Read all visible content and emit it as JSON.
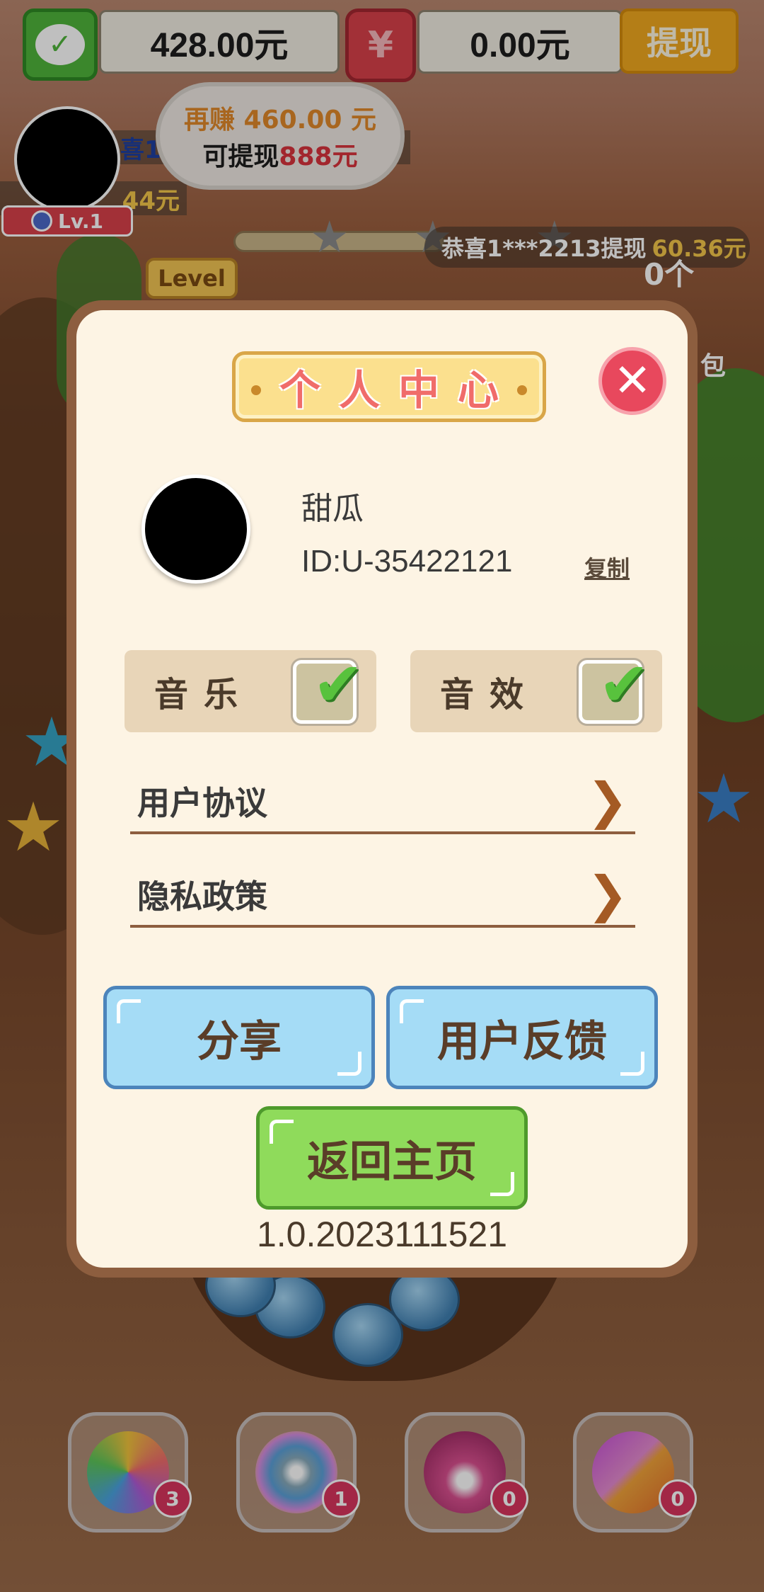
{
  "topbar": {
    "wechat_balance": "428.00元",
    "red_packet_balance": "0.00元",
    "withdraw_label": "提现",
    "yuan_glyph": "¥"
  },
  "player": {
    "level": "Lv.1",
    "obscured_fragment_1": "喜1",
    "obscured_fragment_2": "44元"
  },
  "cloud_tip": {
    "line1": "再赚 460.00 元",
    "line2_prefix": "可提现",
    "line2_amount": "888元"
  },
  "ticker": {
    "text": "恭喜1***2213提现",
    "amount": "60.36元"
  },
  "level_tab": "Level",
  "counter_label": "0个",
  "side_label": "包",
  "modal": {
    "title": "个人中心",
    "close_glyph": "✕",
    "nickname": "甜瓜",
    "user_id": "ID:U-35422121",
    "copy_label": "复制",
    "music_label": "音乐",
    "sound_label": "音效",
    "music_enabled": true,
    "sound_enabled": true,
    "check_glyph": "✔",
    "user_agreement": "用户协议",
    "privacy_policy": "隐私政策",
    "chevron": "❯",
    "share_label": "分享",
    "feedback_label": "用户反馈",
    "home_label": "返回主页",
    "version": "1.0.2023111521"
  },
  "tools": [
    {
      "name": "rainbow-candy",
      "count": "3"
    },
    {
      "name": "color-bomb",
      "count": "1"
    },
    {
      "name": "skull-potion",
      "count": "0"
    },
    {
      "name": "spinning-top",
      "count": "0"
    }
  ],
  "colors": {
    "modal_frame": "#8d5e3f",
    "modal_bg": "#fdf4e4",
    "title_text": "#f06c6a",
    "close_button": "#e8485d",
    "blue_button": "#a5dcf6",
    "green_button": "#8fdb5b"
  }
}
